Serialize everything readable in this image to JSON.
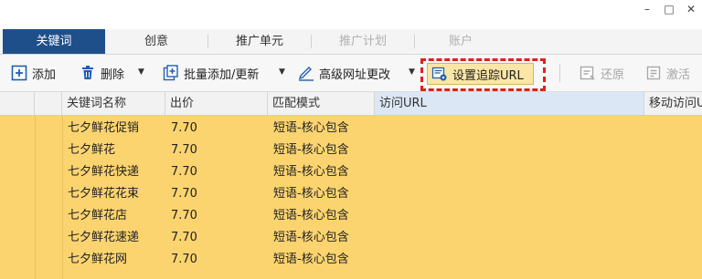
{
  "window": {
    "minimize": "–",
    "maximize": "□",
    "close": "✕"
  },
  "tabs": [
    {
      "label": "关键词",
      "state": "active"
    },
    {
      "label": "创意",
      "state": "normal"
    },
    {
      "label": "推广单元",
      "state": "normal"
    },
    {
      "label": "推广计划",
      "state": "disabled"
    },
    {
      "label": "账户",
      "state": "disabled"
    }
  ],
  "toolbar": {
    "add_label": "添加",
    "delete_label": "删除",
    "bulk_add_label": "批量添加/更新",
    "advanced_url_label": "高级网址更改",
    "set_tracking_url_label": "设置追踪URL",
    "restore_label": "还原",
    "activate_label": "激活"
  },
  "table": {
    "columns": [
      "关键词名称",
      "出价",
      "匹配模式",
      "访问URL",
      "移动访问U"
    ],
    "rows": [
      {
        "keyword": "七夕鲜花促销",
        "bid": "7.70",
        "match": "短语-核心包含"
      },
      {
        "keyword": "七夕鲜花",
        "bid": "7.70",
        "match": "短语-核心包含"
      },
      {
        "keyword": "七夕鲜花快递",
        "bid": "7.70",
        "match": "短语-核心包含"
      },
      {
        "keyword": "七夕鲜花花束",
        "bid": "7.70",
        "match": "短语-核心包含"
      },
      {
        "keyword": "七夕鲜花店",
        "bid": "7.70",
        "match": "短语-核心包含"
      },
      {
        "keyword": "七夕鲜花速递",
        "bid": "7.70",
        "match": "短语-核心包含"
      },
      {
        "keyword": "七夕鲜花网",
        "bid": "7.70",
        "match": "短语-核心包含"
      }
    ]
  },
  "colors": {
    "active_tab": "#1f4f8a",
    "row_highlight": "#fbd46f",
    "highlight_border": "#e0201b",
    "button_highlight": "#fbe6a6"
  }
}
